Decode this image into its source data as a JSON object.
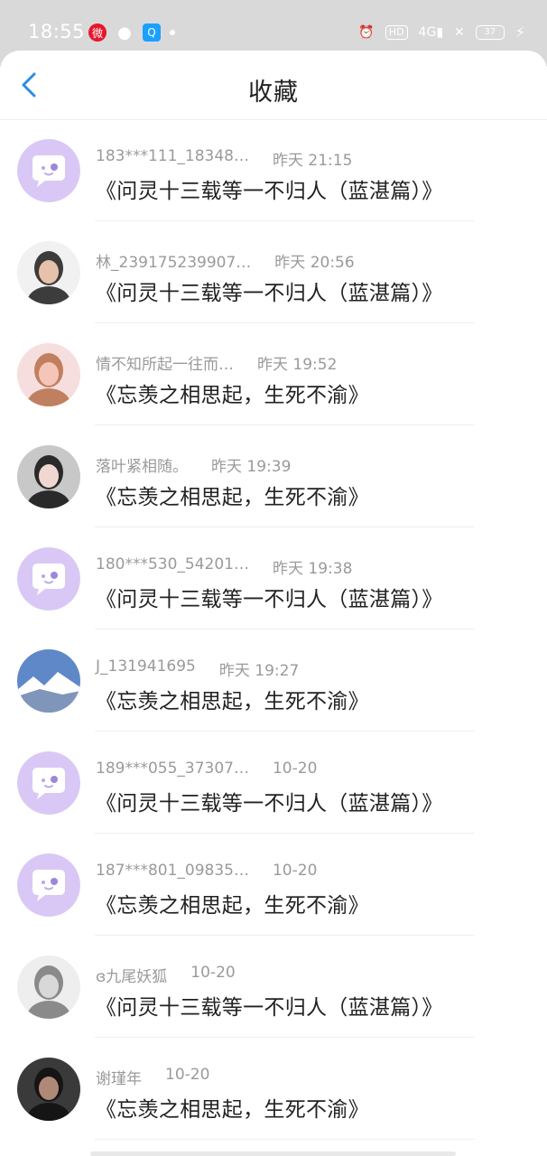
{
  "status_bar": {
    "time": "18:55",
    "network": "4G",
    "hd": "HD",
    "battery": "37"
  },
  "header": {
    "title": "收藏"
  },
  "items": [
    {
      "user": "183***111_18348…",
      "time": "昨天 21:15",
      "title": "《问灵十三载等一不归人（蓝湛篇）》",
      "avatar": "default"
    },
    {
      "user": "林_239175239907…",
      "time": "昨天 20:56",
      "title": "《问灵十三载等一不归人（蓝湛篇）》",
      "avatar": "photo-girl"
    },
    {
      "user": "情不知所起一往而…",
      "time": "昨天 19:52",
      "title": "《忘羡之相思起，生死不渝》",
      "avatar": "anime-girl"
    },
    {
      "user": "落叶紧相随。",
      "time": "昨天 19:39",
      "title": "《忘羡之相思起，生死不渝》",
      "avatar": "photo-woman"
    },
    {
      "user": "180***530_54201…",
      "time": "昨天 19:38",
      "title": "《问灵十三载等一不归人（蓝湛篇）》",
      "avatar": "default"
    },
    {
      "user": "J_131941695",
      "time": "昨天 19:27",
      "title": "《忘羡之相思起，生死不渝》",
      "avatar": "landscape"
    },
    {
      "user": "189***055_37307…",
      "time": "10-20",
      "title": "《问灵十三载等一不归人（蓝湛篇）》",
      "avatar": "default"
    },
    {
      "user": "187***801_09835…",
      "time": "10-20",
      "title": "《忘羡之相思起，生死不渝》",
      "avatar": "default"
    },
    {
      "user": "ɞ九尾妖狐",
      "time": "10-20",
      "title": "《问灵十三载等一不归人（蓝湛篇）》",
      "avatar": "sketch"
    },
    {
      "user": "谢瑾年",
      "time": "10-20",
      "title": "《忘羡之相思起，生死不渝》",
      "avatar": "photo-dark"
    }
  ]
}
